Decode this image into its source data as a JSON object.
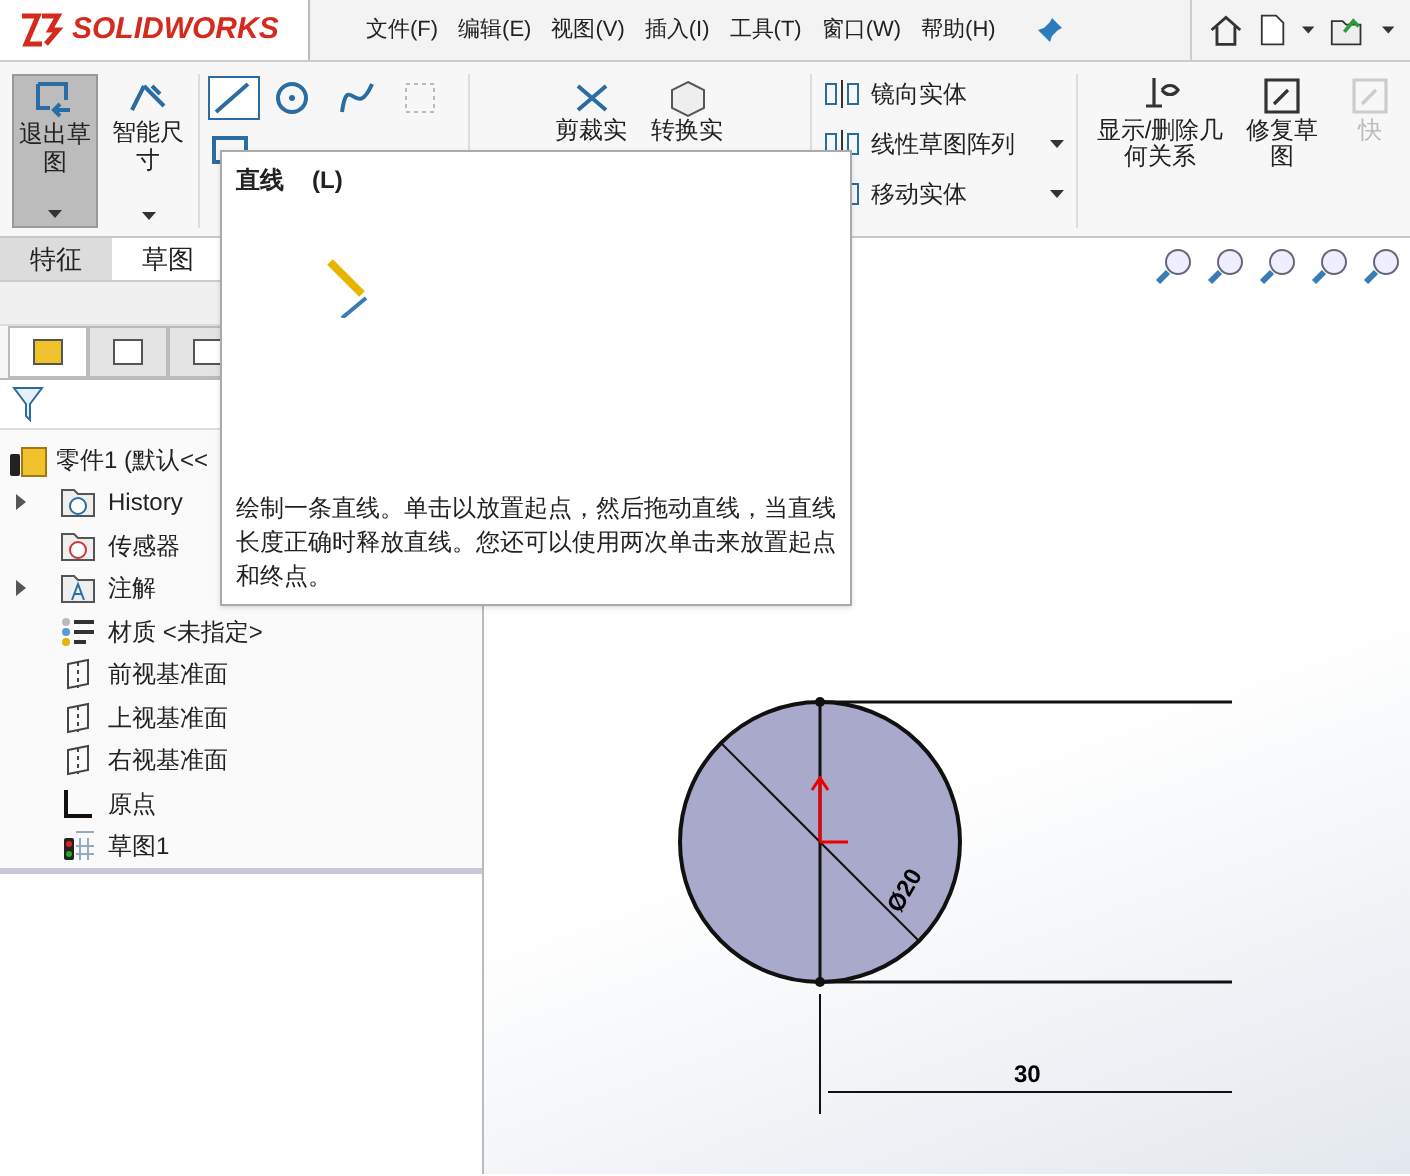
{
  "title_bar": {
    "logo": "SOLIDWORKS",
    "menus": [
      "文件(F)",
      "编辑(E)",
      "视图(V)",
      "插入(I)",
      "工具(T)",
      "窗口(W)",
      "帮助(H)"
    ]
  },
  "ribbon": {
    "large_buttons": [
      {
        "label": "退出草图",
        "selected": true
      },
      {
        "label": "智能尺寸",
        "selected": false
      }
    ],
    "partial_buttons": [
      "剪裁实",
      "转换实"
    ],
    "list_buttons": [
      {
        "label": "镜向实体",
        "dropdown": false
      },
      {
        "label": "线性草图阵列",
        "dropdown": true
      },
      {
        "label": "移动实体",
        "dropdown": true
      }
    ],
    "right_buttons": [
      {
        "label": "显示/删除几何关系",
        "disabled": false
      },
      {
        "label": "修复草图",
        "disabled": false
      },
      {
        "label": "快",
        "disabled": true
      }
    ]
  },
  "panel_tabs": [
    {
      "selected": true
    },
    {
      "selected": false
    },
    {
      "selected": false
    }
  ],
  "tabs": [
    {
      "label": "特征",
      "selected": false
    },
    {
      "label": "草图",
      "selected": true
    }
  ],
  "tooltip": {
    "title": "直线",
    "shortcut": "(L)",
    "description": "绘制一条直线。单击以放置起点，然后拖动直线，当直线长度正确时释放直线。您还可以使用两次单击来放置起点和终点。"
  },
  "tree": {
    "root": "零件1 (默认<<",
    "items": [
      {
        "label": "History",
        "kind": "history",
        "expanded": false
      },
      {
        "label": "传感器",
        "kind": "sensor"
      },
      {
        "label": "注解",
        "kind": "annotation",
        "expanded": false
      },
      {
        "label": "材质 <未指定>",
        "kind": "material"
      },
      {
        "label": "前视基准面",
        "kind": "plane"
      },
      {
        "label": "上视基准面",
        "kind": "plane"
      },
      {
        "label": "右视基准面",
        "kind": "plane"
      },
      {
        "label": "原点",
        "kind": "origin"
      },
      {
        "label": "草图1",
        "kind": "sketch"
      }
    ]
  },
  "sketch": {
    "diameter": "Ø20",
    "length": "30"
  }
}
